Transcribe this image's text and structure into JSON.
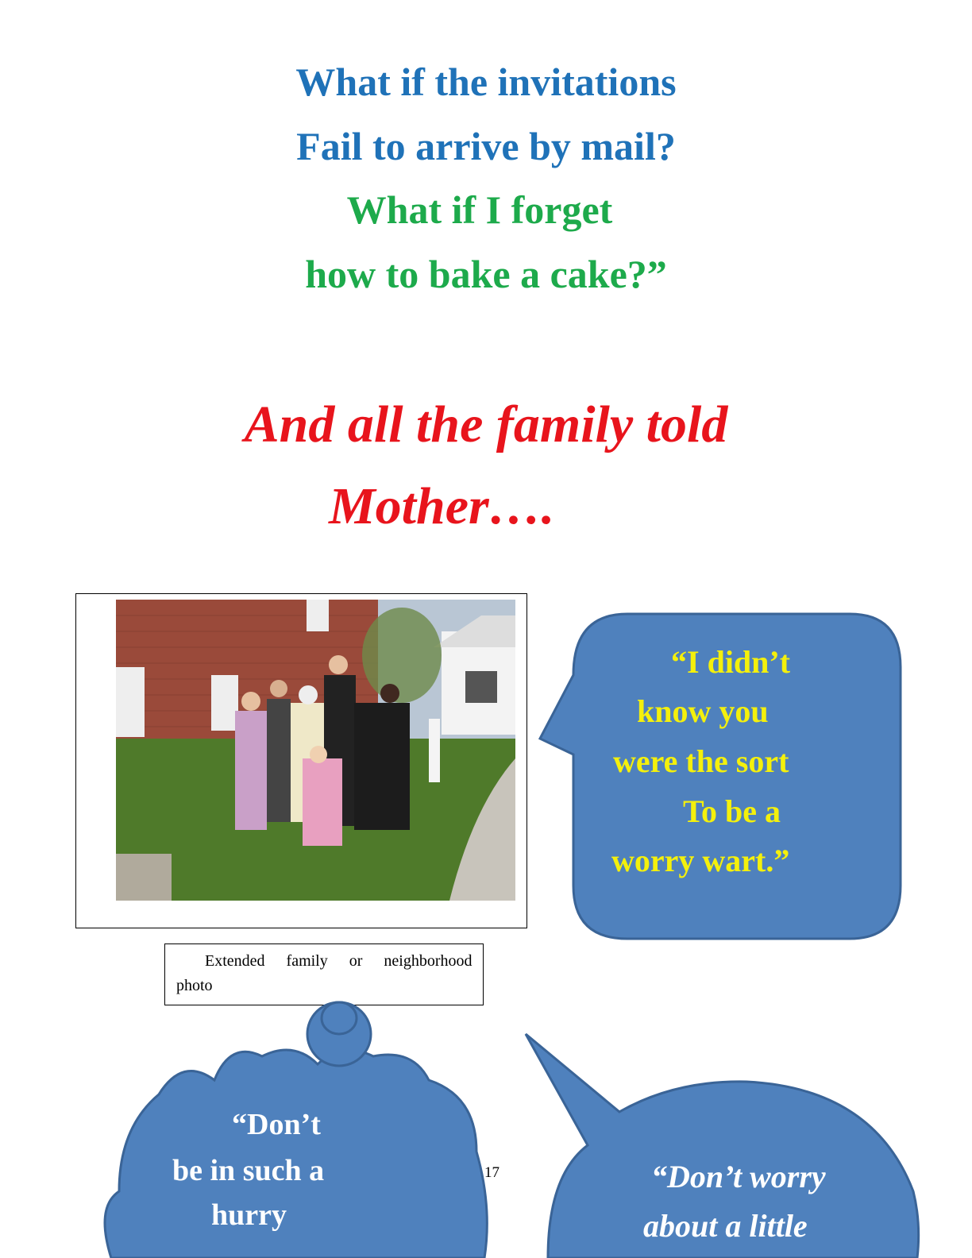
{
  "verses": [
    {
      "text": "What if the invitations",
      "color": "#1f72b8"
    },
    {
      "text": "Fail to arrive by mail?",
      "color": "#1f72b8"
    },
    {
      "text": "What if I forget",
      "color": "#1daa4b"
    },
    {
      "text": "how to bake a cake?”",
      "color": "#1daa4b"
    }
  ],
  "heading": {
    "line1": "And all the family told",
    "line2": "Mother….",
    "color": "#e8141c"
  },
  "photo": {
    "caption_line1": "Extended family or neighborhood",
    "caption_line2": "photo"
  },
  "bubbles": {
    "right": {
      "lines": [
        "“I didn’t",
        "know you",
        "were the sort",
        "To be a",
        "worry wart.”"
      ],
      "text_color": "#f4f00c",
      "fill": "#4f81bd"
    },
    "cloud": {
      "lines": [
        "“Don’t",
        "be in such a",
        "hurry"
      ],
      "text_color": "#ffffff",
      "fill": "#4f81bd"
    },
    "bottom_right": {
      "lines": [
        "“Don’t worry",
        "about a little"
      ],
      "text_color": "#ffffff",
      "fill": "#4f81bd"
    }
  },
  "page_number": "17"
}
